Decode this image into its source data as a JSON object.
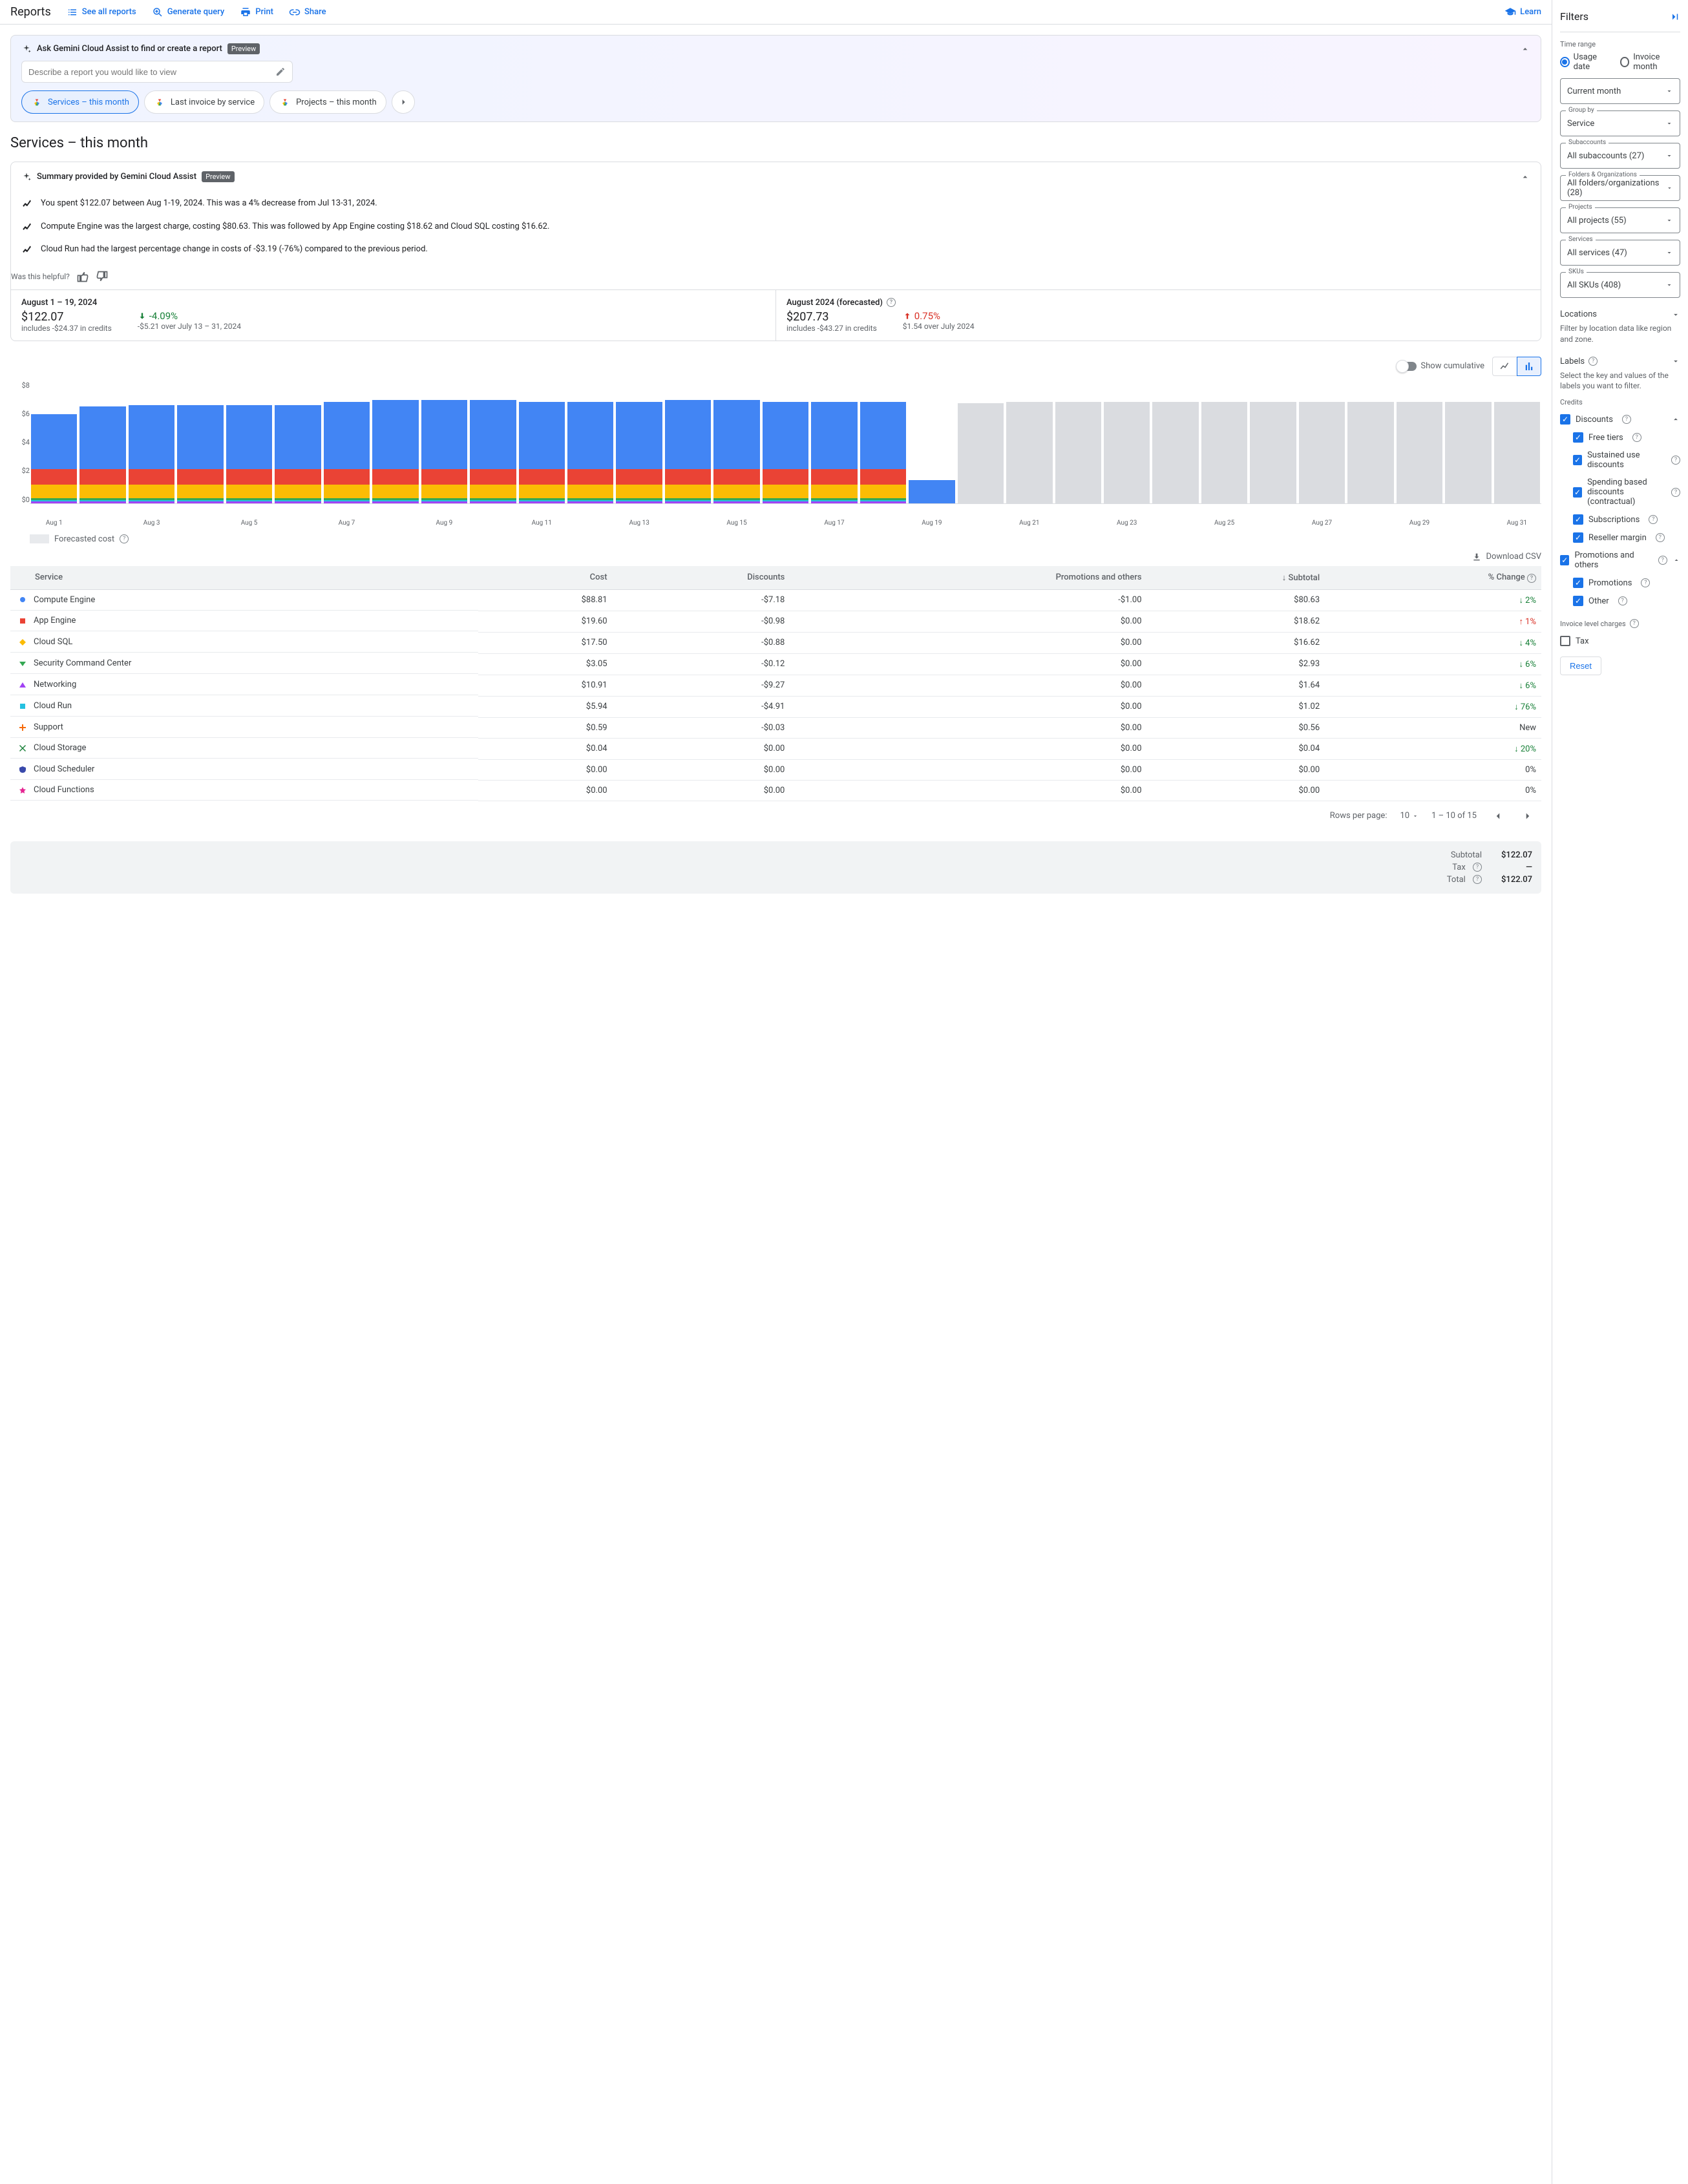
{
  "page": "Reports",
  "topbar": {
    "see_all": "See all reports",
    "generate": "Generate query",
    "print": "Print",
    "share": "Share",
    "learn": "Learn"
  },
  "gemini": {
    "title": "Ask Gemini Cloud Assist to find or create a report",
    "preview": "Preview",
    "placeholder": "Describe a report you would like to view",
    "chips": [
      "Services – this month",
      "Last invoice by service",
      "Projects – this month"
    ]
  },
  "report_title": "Services – this month",
  "summary": {
    "title": "Summary provided by Gemini Cloud Assist",
    "preview": "Preview",
    "insights": [
      "You spent $122.07 between Aug 1-19, 2024. This was a 4% decrease from Jul 13-31, 2024.",
      "Compute Engine was the largest charge, costing $80.63. This was followed by App Engine costing $18.62 and Cloud SQL costing $16.62.",
      "Cloud Run had the largest percentage change in costs of -$3.19 (-76%) compared to the previous period."
    ],
    "helpful": "Was this helpful?"
  },
  "stats": {
    "left": {
      "title": "August 1 – 19, 2024",
      "value": "$122.07",
      "sub": "includes -$24.37 in credits",
      "pct": "-4.09%",
      "pct_sub": "-$5.21 over July 13 – 31, 2024"
    },
    "right": {
      "title": "August 2024 (forecasted)",
      "value": "$207.73",
      "sub": "includes -$43.27 in credits",
      "pct": "0.75%",
      "pct_sub": "$1.54 over July 2024"
    }
  },
  "chart_toggle": "Show cumulative",
  "forecast_label": "Forecasted cost",
  "download": "Download CSV",
  "chart_data": {
    "type": "bar",
    "ylabel": "$",
    "ylim": [
      0,
      8
    ],
    "yticks": [
      "$8",
      "$6",
      "$4",
      "$2",
      "$0"
    ],
    "categories": [
      "Aug 1",
      "",
      "Aug 3",
      "",
      "Aug 5",
      "",
      "Aug 7",
      "",
      "Aug 9",
      "",
      "Aug 11",
      "",
      "Aug 13",
      "",
      "Aug 15",
      "",
      "Aug 17",
      "",
      "Aug 19",
      "",
      "Aug 21",
      "",
      "Aug 23",
      "",
      "Aug 25",
      "",
      "Aug 27",
      "",
      "Aug 29",
      "",
      "Aug 31"
    ],
    "series_colors": {
      "Compute Engine": "#4285f4",
      "App Engine": "#ea4335",
      "Cloud SQL": "#fbbc04",
      "Security Command Center": "#34a853",
      "Networking": "#a142f4",
      "Cloud Run": "#24c1e0"
    },
    "days": [
      {
        "compute": 3.6,
        "app": 1.0,
        "sql": 0.9,
        "other": 0.3,
        "forecast": false
      },
      {
        "compute": 4.1,
        "app": 1.0,
        "sql": 0.9,
        "other": 0.3,
        "forecast": false
      },
      {
        "compute": 4.2,
        "app": 1.0,
        "sql": 0.9,
        "other": 0.3,
        "forecast": false
      },
      {
        "compute": 4.2,
        "app": 1.0,
        "sql": 0.9,
        "other": 0.3,
        "forecast": false
      },
      {
        "compute": 4.2,
        "app": 1.0,
        "sql": 0.9,
        "other": 0.3,
        "forecast": false
      },
      {
        "compute": 4.2,
        "app": 1.0,
        "sql": 0.9,
        "other": 0.3,
        "forecast": false
      },
      {
        "compute": 4.4,
        "app": 1.0,
        "sql": 0.9,
        "other": 0.3,
        "forecast": false
      },
      {
        "compute": 4.5,
        "app": 1.0,
        "sql": 0.9,
        "other": 0.3,
        "forecast": false
      },
      {
        "compute": 4.5,
        "app": 1.0,
        "sql": 0.9,
        "other": 0.3,
        "forecast": false
      },
      {
        "compute": 4.5,
        "app": 1.0,
        "sql": 0.9,
        "other": 0.3,
        "forecast": false
      },
      {
        "compute": 4.4,
        "app": 1.0,
        "sql": 0.9,
        "other": 0.3,
        "forecast": false
      },
      {
        "compute": 4.4,
        "app": 1.0,
        "sql": 0.9,
        "other": 0.3,
        "forecast": false
      },
      {
        "compute": 4.4,
        "app": 1.0,
        "sql": 0.9,
        "other": 0.3,
        "forecast": false
      },
      {
        "compute": 4.5,
        "app": 1.0,
        "sql": 0.9,
        "other": 0.3,
        "forecast": false
      },
      {
        "compute": 4.5,
        "app": 1.0,
        "sql": 0.9,
        "other": 0.3,
        "forecast": false
      },
      {
        "compute": 4.4,
        "app": 1.0,
        "sql": 0.9,
        "other": 0.3,
        "forecast": false
      },
      {
        "compute": 4.4,
        "app": 1.0,
        "sql": 0.9,
        "other": 0.3,
        "forecast": false
      },
      {
        "compute": 4.4,
        "app": 1.0,
        "sql": 0.9,
        "other": 0.3,
        "forecast": false
      },
      {
        "compute": 1.5,
        "app": 0.0,
        "sql": 0.0,
        "other": 0.0,
        "forecast": false
      },
      {
        "compute": 0,
        "app": 0,
        "sql": 0,
        "other": 0,
        "forecast": true,
        "fc": 6.5
      },
      {
        "compute": 0,
        "app": 0,
        "sql": 0,
        "other": 0,
        "forecast": true,
        "fc": 6.6
      },
      {
        "compute": 0,
        "app": 0,
        "sql": 0,
        "other": 0,
        "forecast": true,
        "fc": 6.6
      },
      {
        "compute": 0,
        "app": 0,
        "sql": 0,
        "other": 0,
        "forecast": true,
        "fc": 6.6
      },
      {
        "compute": 0,
        "app": 0,
        "sql": 0,
        "other": 0,
        "forecast": true,
        "fc": 6.6
      },
      {
        "compute": 0,
        "app": 0,
        "sql": 0,
        "other": 0,
        "forecast": true,
        "fc": 6.6
      },
      {
        "compute": 0,
        "app": 0,
        "sql": 0,
        "other": 0,
        "forecast": true,
        "fc": 6.6
      },
      {
        "compute": 0,
        "app": 0,
        "sql": 0,
        "other": 0,
        "forecast": true,
        "fc": 6.6
      },
      {
        "compute": 0,
        "app": 0,
        "sql": 0,
        "other": 0,
        "forecast": true,
        "fc": 6.6
      },
      {
        "compute": 0,
        "app": 0,
        "sql": 0,
        "other": 0,
        "forecast": true,
        "fc": 6.6
      },
      {
        "compute": 0,
        "app": 0,
        "sql": 0,
        "other": 0,
        "forecast": true,
        "fc": 6.6
      },
      {
        "compute": 0,
        "app": 0,
        "sql": 0,
        "other": 0,
        "forecast": true,
        "fc": 6.6
      }
    ]
  },
  "table": {
    "headers": [
      "Service",
      "Cost",
      "Discounts",
      "Promotions and others",
      "Subtotal",
      "% Change"
    ],
    "sort_arrow": "↓",
    "rows": [
      {
        "name": "Compute Engine",
        "cost": "$88.81",
        "disc": "-$7.18",
        "promo": "-$1.00",
        "sub": "$80.63",
        "chg": "2%",
        "dir": "down",
        "color": "#4285f4",
        "shape": "circle"
      },
      {
        "name": "App Engine",
        "cost": "$19.60",
        "disc": "-$0.98",
        "promo": "$0.00",
        "sub": "$18.62",
        "chg": "1%",
        "dir": "up",
        "color": "#ea4335",
        "shape": "square"
      },
      {
        "name": "Cloud SQL",
        "cost": "$17.50",
        "disc": "-$0.88",
        "promo": "$0.00",
        "sub": "$16.62",
        "chg": "4%",
        "dir": "down",
        "color": "#fbbc04",
        "shape": "diamond"
      },
      {
        "name": "Security Command Center",
        "cost": "$3.05",
        "disc": "-$0.12",
        "promo": "$0.00",
        "sub": "$2.93",
        "chg": "6%",
        "dir": "down",
        "color": "#34a853",
        "shape": "tri-down"
      },
      {
        "name": "Networking",
        "cost": "$10.91",
        "disc": "-$9.27",
        "promo": "$0.00",
        "sub": "$1.64",
        "chg": "6%",
        "dir": "down",
        "color": "#a142f4",
        "shape": "tri-up"
      },
      {
        "name": "Cloud Run",
        "cost": "$5.94",
        "disc": "-$4.91",
        "promo": "$0.00",
        "sub": "$1.02",
        "chg": "76%",
        "dir": "down",
        "color": "#24c1e0",
        "shape": "square"
      },
      {
        "name": "Support",
        "cost": "$0.59",
        "disc": "-$0.03",
        "promo": "$0.00",
        "sub": "$0.56",
        "chg": "New",
        "dir": "none",
        "color": "#f66a0a",
        "shape": "plus"
      },
      {
        "name": "Cloud Storage",
        "cost": "$0.04",
        "disc": "$0.00",
        "promo": "$0.00",
        "sub": "$0.04",
        "chg": "20%",
        "dir": "down",
        "color": "#188038",
        "shape": "cross"
      },
      {
        "name": "Cloud Scheduler",
        "cost": "$0.00",
        "disc": "$0.00",
        "promo": "$0.00",
        "sub": "$0.00",
        "chg": "0%",
        "dir": "none",
        "color": "#3949ab",
        "shape": "shield"
      },
      {
        "name": "Cloud Functions",
        "cost": "$0.00",
        "disc": "$0.00",
        "promo": "$0.00",
        "sub": "$0.00",
        "chg": "0%",
        "dir": "none",
        "color": "#e52592",
        "shape": "star"
      }
    ]
  },
  "pager": {
    "label": "Rows per page:",
    "size": "10",
    "range": "1 – 10 of 15"
  },
  "totals": {
    "subtotal_l": "Subtotal",
    "subtotal_v": "$122.07",
    "tax_l": "Tax",
    "tax_v": "—",
    "total_l": "Total",
    "total_v": "$122.07"
  },
  "filters": {
    "title": "Filters",
    "time_range_label": "Time range",
    "usage_date": "Usage date",
    "invoice_month": "Invoice month",
    "current_month": "Current month",
    "group_by_label": "Group by",
    "group_by": "Service",
    "subaccounts_label": "Subaccounts",
    "subaccounts": "All subaccounts (27)",
    "folders_label": "Folders & Organizations",
    "folders": "All folders/organizations (28)",
    "projects_label": "Projects",
    "projects": "All projects (55)",
    "services_label": "Services",
    "services": "All services (47)",
    "skus_label": "SKUs",
    "skus": "All SKUs (408)",
    "locations": "Locations",
    "locations_sub": "Filter by location data like region and zone.",
    "labels": "Labels",
    "labels_sub": "Select the key and values of the labels you want to filter.",
    "credits": "Credits",
    "discounts": "Discounts",
    "free_tiers": "Free tiers",
    "sustained": "Sustained use discounts",
    "spending": "Spending based discounts (contractual)",
    "subscriptions": "Subscriptions",
    "reseller": "Reseller margin",
    "promotions_others": "Promotions and others",
    "promotions": "Promotions",
    "other": "Other",
    "invoice_level": "Invoice level charges",
    "tax": "Tax",
    "reset": "Reset"
  }
}
